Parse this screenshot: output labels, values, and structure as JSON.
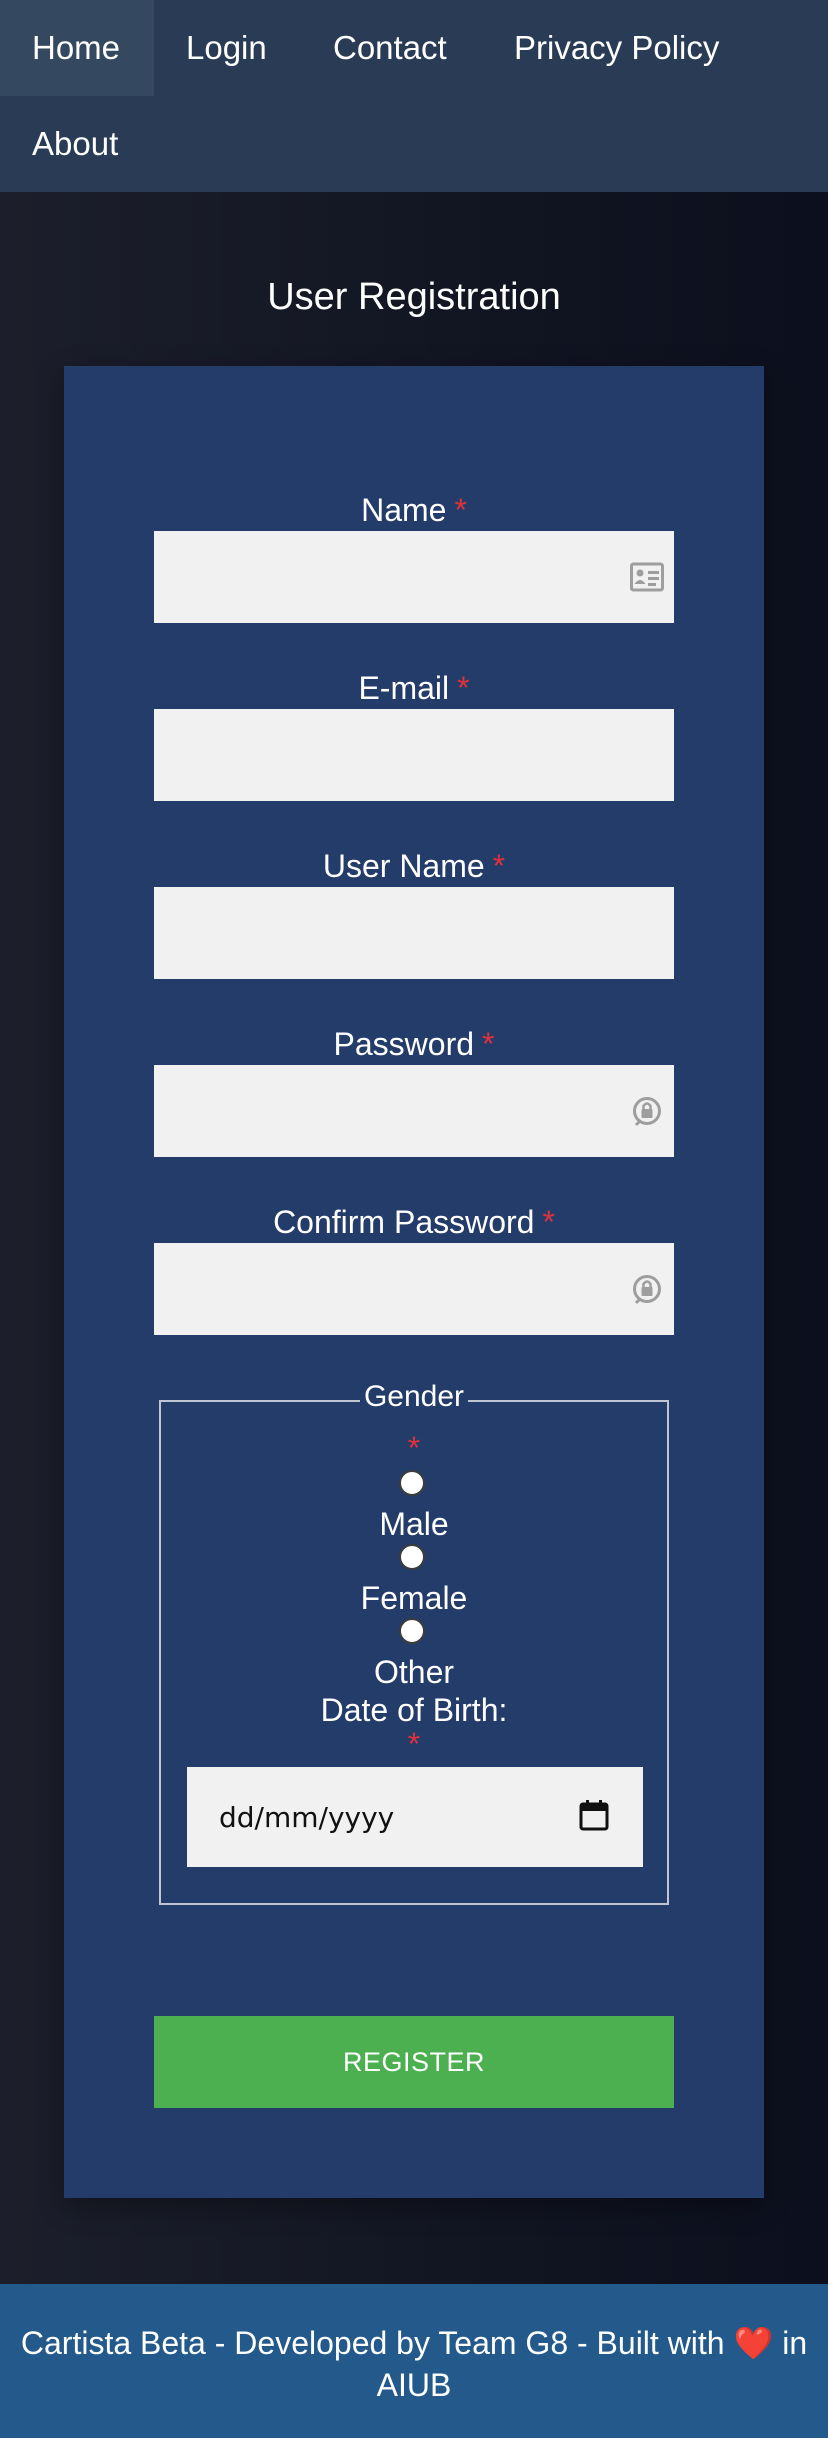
{
  "nav": {
    "items": [
      {
        "label": "Home",
        "active": true
      },
      {
        "label": "Login"
      },
      {
        "label": "Contact"
      },
      {
        "label": "Privacy Policy"
      },
      {
        "label": "About"
      }
    ]
  },
  "page": {
    "title": "User Registration"
  },
  "form": {
    "required_marker": "*",
    "fields": [
      {
        "label": "Name",
        "icon": "id-card-icon",
        "value": ""
      },
      {
        "label": "E-mail",
        "value": ""
      },
      {
        "label": "User Name",
        "value": ""
      },
      {
        "label": "Password",
        "icon": "password-lock-icon",
        "value": ""
      },
      {
        "label": "Confirm Password",
        "icon": "password-lock-icon",
        "value": ""
      }
    ],
    "gender": {
      "legend": "Gender",
      "options": [
        "Male",
        "Female",
        "Other"
      ],
      "selected": null
    },
    "dob": {
      "label": "Date of Birth:",
      "placeholder": "dd/mm/yyyy",
      "icon": "calendar-icon"
    },
    "submit_label": "REGISTER"
  },
  "footer": {
    "text_before": "Cartista Beta - Developed by Team G8 - Built with",
    "heart": "❤️",
    "text_after": "in AIUB"
  },
  "colors": {
    "nav_bg": "#2a3c55",
    "card_bg": "#243c6a",
    "required": "#e0313a",
    "button": "#4caf50",
    "footer_bg": "#235a8b"
  }
}
